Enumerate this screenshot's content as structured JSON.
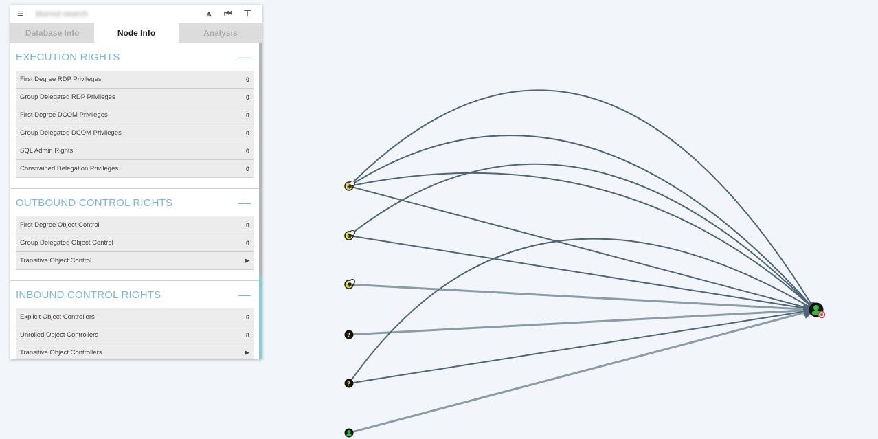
{
  "toolbar": {
    "search_value": "blurred search",
    "menu_icon": "hamburger-icon",
    "pathfinding_icon": "pathfinding-icon",
    "back_icon": "back-icon",
    "filter_icon": "filter-icon"
  },
  "tabs": [
    {
      "label": "Database Info",
      "active": false
    },
    {
      "label": "Node Info",
      "active": true
    },
    {
      "label": "Analysis",
      "active": false
    }
  ],
  "sections": [
    {
      "title": "EXECUTION RIGHTS",
      "rows": [
        {
          "label": "First Degree RDP Privileges",
          "value": "0"
        },
        {
          "label": "Group Delegated RDP Privileges",
          "value": "0"
        },
        {
          "label": "First Degree DCOM Privileges",
          "value": "0"
        },
        {
          "label": "Group Delegated DCOM Privileges",
          "value": "0"
        },
        {
          "label": "SQL Admin Rights",
          "value": "0"
        },
        {
          "label": "Constrained Delegation Privileges",
          "value": "0"
        }
      ]
    },
    {
      "title": "OUTBOUND CONTROL RIGHTS",
      "rows": [
        {
          "label": "First Degree Object Control",
          "value": "0"
        },
        {
          "label": "Group Delegated Object Control",
          "value": "0"
        },
        {
          "label": "Transitive Object Control",
          "value": "▶"
        }
      ]
    },
    {
      "title": "INBOUND CONTROL RIGHTS",
      "rows": [
        {
          "label": "Explicit Object Controllers",
          "value": "6"
        },
        {
          "label": "Unrolled Object Controllers",
          "value": "8"
        },
        {
          "label": "Transitive Object Controllers",
          "value": "▶"
        }
      ]
    }
  ],
  "graph": {
    "edge_color": "#4f6677",
    "light_edge_color": "#8a9ca8",
    "user_node_color": "#e6e64c",
    "unknown_node_color": "#f0e020",
    "group_node_color": "#2bc03a",
    "target_badge_color": "#e04040"
  }
}
